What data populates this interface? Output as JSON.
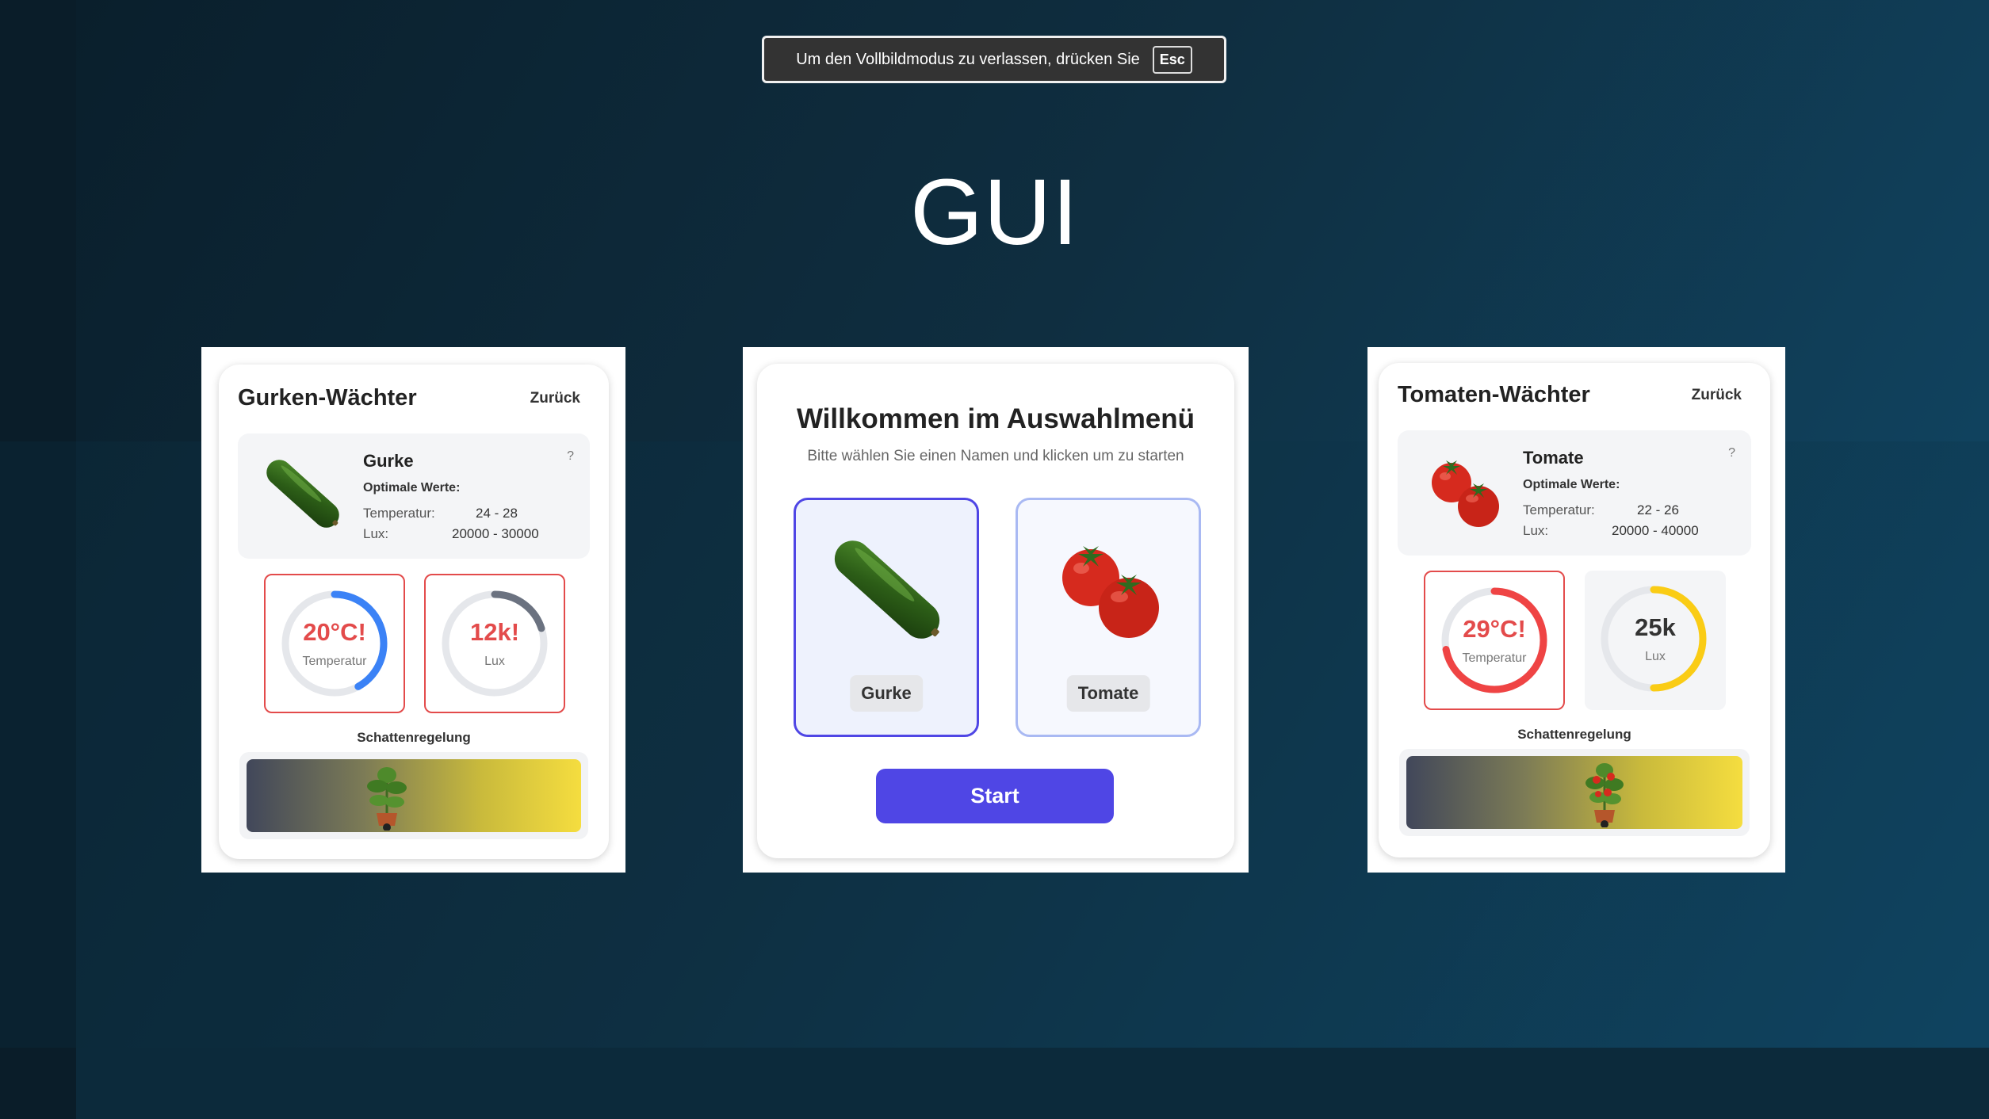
{
  "fullscreen_notice": {
    "text": "Um den Vollbildmodus zu verlassen, drücken Sie",
    "key": "Esc"
  },
  "page": {
    "title": "GUI"
  },
  "cucumber_panel": {
    "title": "Gurken-Wächter",
    "back_label": "Zurück",
    "info": {
      "name": "Gurke",
      "help": "?",
      "optimal_label": "Optimale Werte:",
      "temp_label": "Temperatur:",
      "temp_range": "24 - 28",
      "lux_label": "Lux:",
      "lux_range": "20000 - 30000"
    },
    "temperature_gauge": {
      "value": "20°C!",
      "label": "Temperatur",
      "fill_fraction": 0.42,
      "color": "#3b82f6",
      "alert": true
    },
    "lux_gauge": {
      "value": "12k!",
      "label": "Lux",
      "fill_fraction": 0.2,
      "color": "#6b7280",
      "alert": true
    },
    "shade_label": "Schattenregelung",
    "shade_position": 0.42
  },
  "selection_menu": {
    "title": "Willkommen im Auswahlmenü",
    "subtitle": "Bitte wählen Sie einen Namen und klicken um zu starten",
    "options": [
      {
        "label": "Gurke",
        "selected": true
      },
      {
        "label": "Tomate",
        "selected": false
      }
    ],
    "start_label": "Start"
  },
  "tomato_panel": {
    "title": "Tomaten-Wächter",
    "back_label": "Zurück",
    "info": {
      "name": "Tomate",
      "help": "?",
      "optimal_label": "Optimale Werte:",
      "temp_label": "Temperatur:",
      "temp_range": "22 - 26",
      "lux_label": "Lux:",
      "lux_range": "20000 - 40000"
    },
    "temperature_gauge": {
      "value": "29°C!",
      "label": "Temperatur",
      "fill_fraction": 0.72,
      "color": "#ef4444",
      "alert": true
    },
    "lux_gauge": {
      "value": "25k",
      "label": "Lux",
      "fill_fraction": 0.5,
      "color": "#facc15",
      "alert": false
    },
    "shade_label": "Schattenregelung",
    "shade_position": 0.59
  },
  "colors": {
    "accent": "#4f46e5",
    "alert": "#e34b4b",
    "option_border": "#a9b9f3",
    "text_dark": "#222222"
  }
}
